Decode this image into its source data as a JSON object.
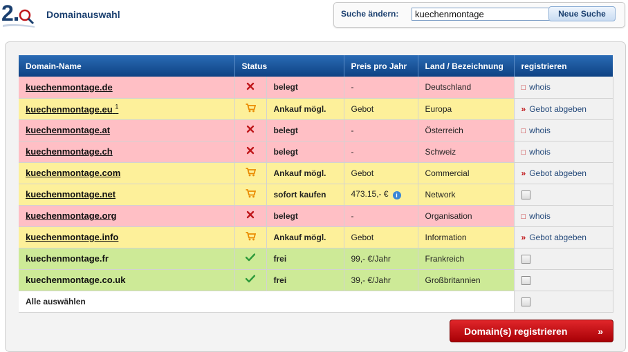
{
  "header": {
    "logo_text": "2.0",
    "title": "Domainauswahl"
  },
  "search": {
    "label": "Suche ändern:",
    "value": "kuechenmontage",
    "button_label": "Neue Suche"
  },
  "table": {
    "columns": [
      "Domain-Name",
      "Status",
      "Preis pro Jahr",
      "Land / Bezeichnung",
      "registrieren"
    ],
    "rows": [
      {
        "domain": "kuechenmontage.de",
        "footnote": "",
        "status_icon": "cross-icon",
        "status": "belegt",
        "price": "-",
        "country": "Deutschland",
        "action": "whois",
        "type": "belegt"
      },
      {
        "domain": "kuechenmontage.eu",
        "footnote": "1",
        "status_icon": "cart-icon",
        "status": "Ankauf mögl.",
        "price": "Gebot",
        "country": "Europa",
        "action": "Gebot abgeben",
        "type": "ankauf"
      },
      {
        "domain": "kuechenmontage.at",
        "footnote": "",
        "status_icon": "cross-icon",
        "status": "belegt",
        "price": "-",
        "country": "Österreich",
        "action": "whois",
        "type": "belegt"
      },
      {
        "domain": "kuechenmontage.ch",
        "footnote": "",
        "status_icon": "cross-icon",
        "status": "belegt",
        "price": "-",
        "country": "Schweiz",
        "action": "whois",
        "type": "belegt"
      },
      {
        "domain": "kuechenmontage.com",
        "footnote": "",
        "status_icon": "cart-icon",
        "status": "Ankauf mögl.",
        "price": "Gebot",
        "country": "Commercial",
        "action": "Gebot abgeben",
        "type": "ankauf"
      },
      {
        "domain": "kuechenmontage.net",
        "footnote": "",
        "status_icon": "cart-icon",
        "status": "sofort kaufen",
        "price": "473.15,- €",
        "country": "Network",
        "action": "",
        "type": "ankauf"
      },
      {
        "domain": "kuechenmontage.org",
        "footnote": "",
        "status_icon": "cross-icon",
        "status": "belegt",
        "price": "-",
        "country": "Organisation",
        "action": "whois",
        "type": "belegt"
      },
      {
        "domain": "kuechenmontage.info",
        "footnote": "",
        "status_icon": "cart-icon",
        "status": "Ankauf mögl.",
        "price": "Gebot",
        "country": "Information",
        "action": "Gebot abgeben",
        "type": "ankauf"
      },
      {
        "domain": "kuechenmontage.fr",
        "footnote": "",
        "status_icon": "check-icon",
        "status": "frei",
        "price": "99,- €/Jahr",
        "country": "Frankreich",
        "action": "",
        "type": "frei"
      },
      {
        "domain": "kuechenmontage.co.uk",
        "footnote": "",
        "status_icon": "check-icon",
        "status": "frei",
        "price": "39,- €/Jahr",
        "country": "Großbritannien",
        "action": "",
        "type": "frei"
      }
    ],
    "select_all_label": "Alle auswählen"
  },
  "submit_button_label": "Domain(s) registrieren",
  "colors": {
    "belegt": "#ffbfc5",
    "ankauf": "#fdf09a",
    "frei": "#cdea97",
    "header": "#0e4283",
    "submit": "#c0171b"
  }
}
